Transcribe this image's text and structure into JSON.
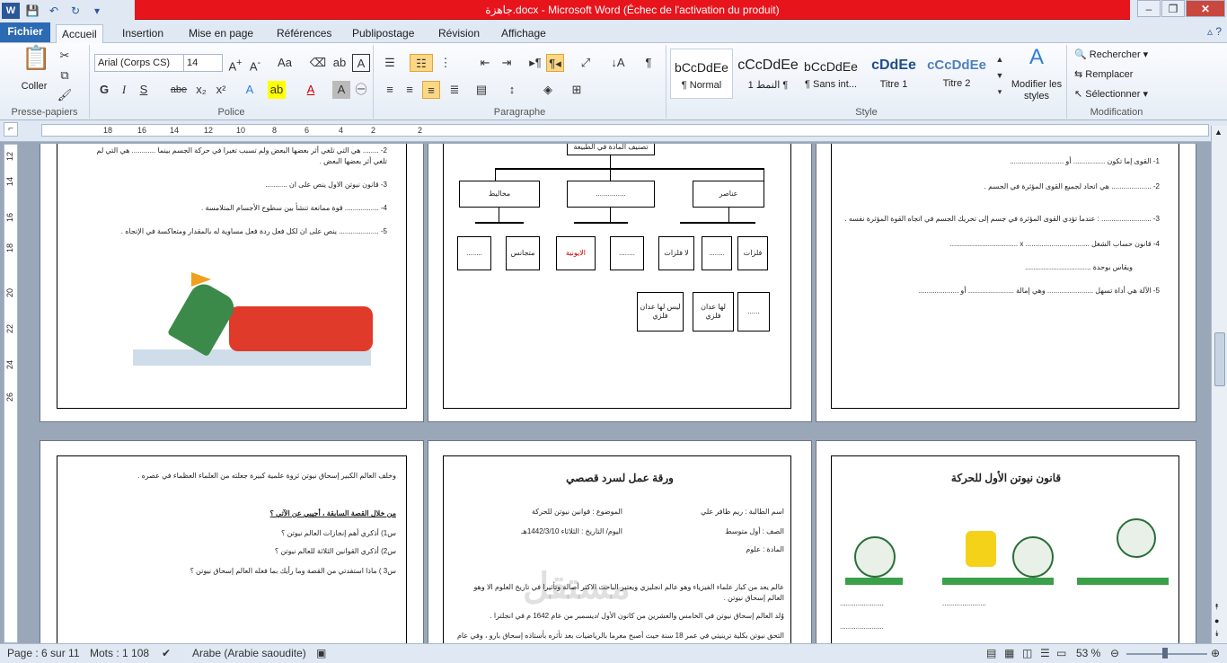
{
  "window": {
    "title": "جاهزة.docx - Microsoft Word (Échec de l'activation du produit)",
    "app_logo": "W"
  },
  "qat": {
    "save": "💾",
    "undo": "↶",
    "redo": "↻",
    "customize": "▾"
  },
  "tabs": [
    {
      "label": "Fichier"
    },
    {
      "label": "Accueil"
    },
    {
      "label": "Insertion"
    },
    {
      "label": "Mise en page"
    },
    {
      "label": "Références"
    },
    {
      "label": "Publipostage"
    },
    {
      "label": "Révision"
    },
    {
      "label": "Affichage"
    }
  ],
  "ribbon": {
    "clipboard": {
      "paste": "Coller",
      "label": "Presse-papiers"
    },
    "font": {
      "name": "Arial (Corps CS)",
      "size": "14",
      "label": "Police",
      "case_btn": "Aa",
      "bold": "G",
      "italic": "I",
      "underline": "S",
      "strike": "abe",
      "sub": "x₂",
      "sup": "x²"
    },
    "paragraph": {
      "label": "Paragraphe",
      "pilcrow": "¶"
    },
    "styles": {
      "label": "Style",
      "items": [
        {
          "sample": "bCcDdEe",
          "name": "¶ Normal"
        },
        {
          "sample": "cCcDdEe",
          "name": "النمط 1 ¶"
        },
        {
          "sample": "bCcDdEe",
          "name": "¶ Sans int..."
        },
        {
          "sample": "cDdEe",
          "name": "Titre 1"
        },
        {
          "sample": "cCcDdEe",
          "name": "Titre 2"
        }
      ],
      "change": "Modifier les styles"
    },
    "editing": {
      "label": "Modification",
      "find": "Rechercher",
      "replace": "Remplacer",
      "select": "Sélectionner"
    }
  },
  "ruler": {
    "h_ticks": [
      "18",
      "16",
      "14",
      "12",
      "10",
      "8",
      "6",
      "4",
      "2",
      "2"
    ],
    "v_ticks": [
      "12",
      "14",
      "16",
      "18",
      "20",
      "22",
      "24",
      "26"
    ]
  },
  "doc": {
    "page1": {
      "lines": [
        "2- ........ هي التي تلغي أثر بعضها البعض ولم تسبب تغيرا في حركة الجسم بينما ............ هي التي لم",
        "تلغي أثر بعضها البعض .",
        "3- قانون نيوتن الاول ينص على ان ...........",
        "4- ................. قوة ممانعة تنشأ بين سطوح الأجسام المتلامسة .",
        "5- .................... ينص على ان لكل فعل ردة فعل مساوية له بالمقدار ومتعاكسة في الإتجاه ."
      ]
    },
    "page2": {
      "top": "تصنيف المادة في الطبيعة",
      "level1": [
        "مخاليط",
        "...............",
        "عناصر"
      ],
      "level2": [
        "........",
        "متجانس",
        "الايونية",
        "........",
        "لا فلزات",
        "........",
        "فلزات"
      ],
      "level3": [
        "ليس لها عدان فلزي",
        "لها عدان فلزي",
        "......"
      ]
    },
    "page3": {
      "lines": [
        "1- القوى إما تكون ................ أو ...........................",
        "2- .................... هي اتحاد لجميع القوى المؤثرة في الجسم .",
        "3- ......................... : عندما تؤدي القوى المؤثرة في جسم إلى تحريك الجسم في اتجاه القوة المؤثرة نفسه .",
        "4- قانون حساب الشغل ................................ x ..................................",
        "ويقاس بوحدة .................................",
        "5- الآلة هي أداة تسهل ....................... وهي إمالة ....................... أو ...................."
      ]
    },
    "page4": {
      "intro": "وخلف العالم الكبير إسحاق نيوتن ثروة علمية كبيرة جعلته من العلماء العظماء في عصره .",
      "q_title": "من خلال القصة السابقة ، أجيبي عن الآتي ؟",
      "q1": "س1) أذكري أهم إنجازات العالم نيوتن ؟",
      "q2": "س2) أذكري القوانين الثلاثة للعالم نيوتن ؟",
      "q3": "س3 ) ماذا استفدتي من القصة وما رأيك بما فعله العالم إسحاق نيوتن ؟"
    },
    "page5": {
      "title": "ورقة عمل لسرد قصصي",
      "name": "اسم الطالبة : ريم ظافر علي",
      "subject_topic": "الموضوع : قوانين نيوتن للحركة",
      "grade": "الصف : أول متوسط",
      "date": "اليوم/ التاريخ : الثلاثاء 1442/3/10هـ",
      "material": "المادة : علوم",
      "p1": "عالم يعد من كبار علماء الفيزياء وهو عالم انجليزي ويعتبر الباحث الاكثر أصالة وتأثيرا في تاريخ العلوم الا وهو",
      "p1b": "العالم إسحاق نيوتن .",
      "p2": "وُلد العالم إسحاق نيوتن في الخامس والعشرين من كانون الأول /ديسمبر من عام 1642 م في انجلترا .",
      "p3": "التحق نيوتن بكلية ترينيتي في عمر 18 سنة حيث أصبح مغرما بالرياضيات بعد تأثره بأستاذه إسحاق بارو ، وفي عام"
    },
    "page6": {
      "title": "قانون نيوتن الأول للحركة",
      "dots1": "......................",
      "dots2": "......................",
      "dots3": "......................"
    }
  },
  "watermark": "مستقل",
  "status": {
    "page": "Page : 6 sur 11",
    "words": "Mots : 1 108",
    "lang": "Arabe (Arabie saoudite)",
    "zoom": "53 %"
  }
}
